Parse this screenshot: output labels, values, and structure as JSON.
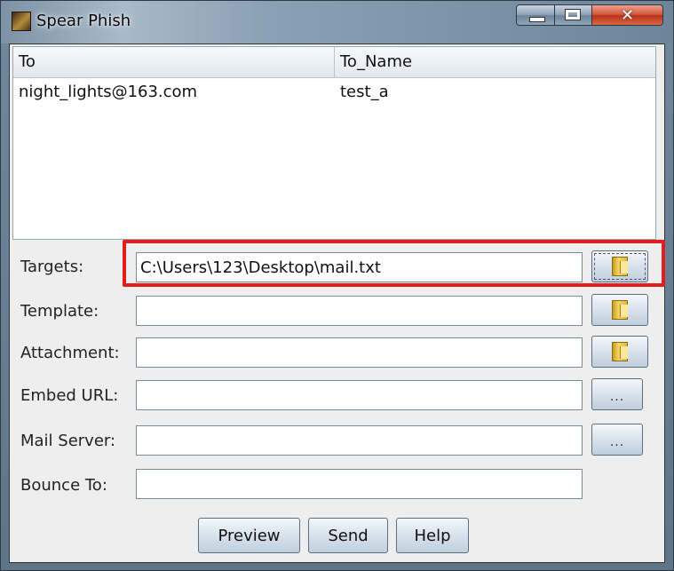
{
  "window": {
    "title": "Spear Phish",
    "close_glyph": "✕"
  },
  "table": {
    "headers": [
      "To",
      "To_Name"
    ],
    "rows": [
      [
        "night_lights@163.com",
        "test_a"
      ]
    ]
  },
  "form": {
    "targets": {
      "label": "Targets:",
      "value": "C:\\Users\\123\\Desktop\\mail.txt"
    },
    "template": {
      "label": "Template:",
      "value": ""
    },
    "attachment": {
      "label": "Attachment:",
      "value": ""
    },
    "embed_url": {
      "label": "Embed URL:",
      "value": "",
      "button_label": "..."
    },
    "mail_server": {
      "label": "Mail Server:",
      "value": "",
      "button_label": "..."
    },
    "bounce_to": {
      "label": "Bounce To:",
      "value": ""
    }
  },
  "buttons": {
    "preview": "Preview",
    "send": "Send",
    "help": "Help"
  },
  "icons": {
    "app": "app-icon",
    "browse": "folder-icon"
  },
  "colors": {
    "highlight": "#e21d1d"
  }
}
